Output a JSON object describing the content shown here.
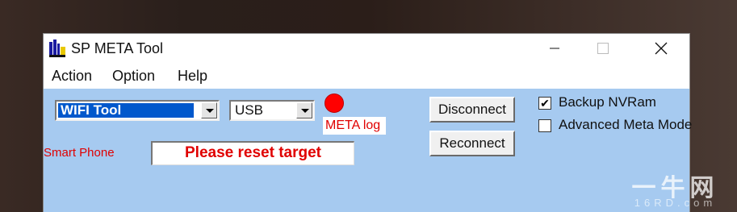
{
  "window": {
    "title": "SP META Tool"
  },
  "menu": {
    "items": [
      "Action",
      "Option",
      "Help"
    ]
  },
  "tool_combo": {
    "value": "WIFI Tool"
  },
  "port_combo": {
    "value": "USB"
  },
  "meta_log": {
    "label": "META log"
  },
  "buttons": {
    "disconnect": "Disconnect",
    "reconnect": "Reconnect"
  },
  "options": {
    "backup_nvram": {
      "label": "Backup NVRam",
      "checked": true
    },
    "advanced_meta_mode": {
      "label": "Advanced Meta Mode",
      "checked": false
    }
  },
  "device": {
    "type_label": "Smart Phone",
    "status": "Please reset target"
  },
  "watermark": {
    "brand": "一牛网",
    "domain": "16RD.com"
  },
  "colors": {
    "client_bg": "#a6caf0",
    "status_red": "#e00000",
    "led": "#ff0000"
  }
}
